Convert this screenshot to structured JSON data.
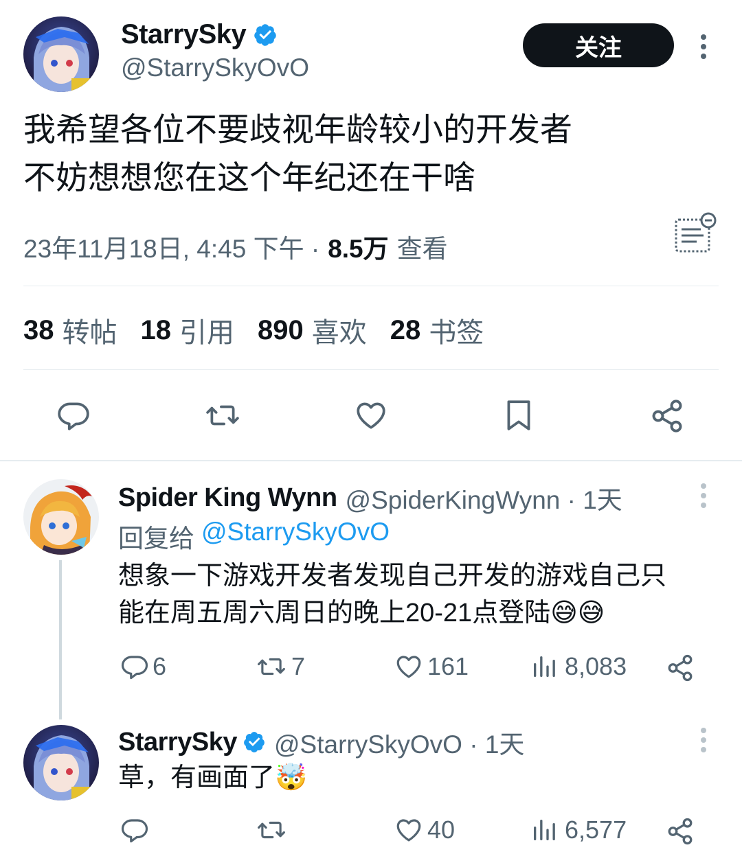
{
  "main_tweet": {
    "author_name": "StarrySky",
    "handle": "@StarrySkyOvO",
    "follow_label": "关注",
    "text_line1": "我希望各位不要歧视年龄较小的开发者",
    "text_line2": "不妨想想您在这个年纪还在干啥",
    "timestamp": "23年11月18日, 4:45 下午 ·",
    "views_count": "8.5万",
    "views_label": "查看",
    "stats": {
      "retweets_count": "38",
      "retweets_label": "转帖",
      "quotes_count": "18",
      "quotes_label": "引用",
      "likes_count": "890",
      "likes_label": "喜欢",
      "bookmarks_count": "28",
      "bookmarks_label": "书签"
    }
  },
  "reply1": {
    "author_name": "Spider King Wynn",
    "handle_time": "@SpiderKingWynn · 1天",
    "reply_to_label": "回复给",
    "reply_to_handle": "@StarrySkyOvO",
    "text_line1": "想象一下游戏开发者发现自己开发的游戏自己只",
    "text_line2": "能在周五周六周日的晚上20-21点登陆😅😅",
    "replies": "6",
    "retweets": "7",
    "likes": "161",
    "views": "8,083"
  },
  "reply2": {
    "author_name": "StarrySky",
    "handle_time": "@StarrySkyOvO · 1天",
    "text": "草，有画面了🤯",
    "likes": "40",
    "views": "6,577"
  },
  "colors": {
    "accent": "#1d9bf0",
    "text": "#0f1419",
    "muted": "#536471",
    "divider": "#e6ecf0"
  }
}
